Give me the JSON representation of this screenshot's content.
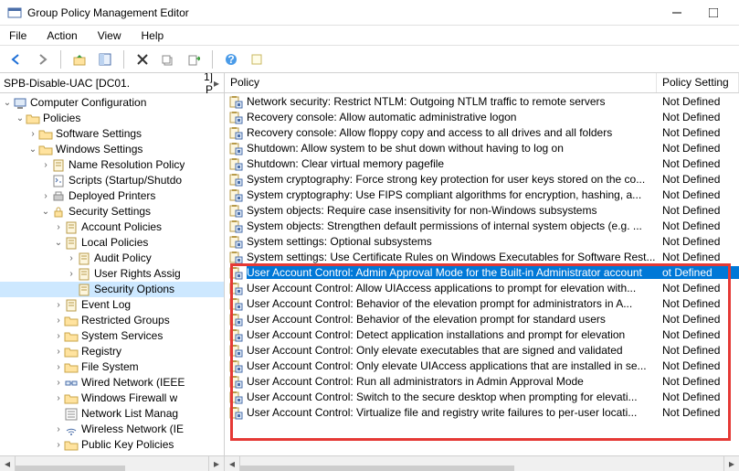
{
  "window": {
    "title": "Group Policy Management Editor"
  },
  "menu": {
    "file": "File",
    "action": "Action",
    "view": "View",
    "help": "Help"
  },
  "tree_header": {
    "label": "SPB-Disable-UAC [DC01.",
    "right": "1] P"
  },
  "tree": [
    {
      "indent": 0,
      "exp": "v",
      "icon": "computer",
      "label": "Computer Configuration"
    },
    {
      "indent": 1,
      "exp": "v",
      "icon": "folder-open",
      "label": "Policies"
    },
    {
      "indent": 2,
      "exp": ">",
      "icon": "folder",
      "label": "Software Settings"
    },
    {
      "indent": 2,
      "exp": "v",
      "icon": "folder-open",
      "label": "Windows Settings"
    },
    {
      "indent": 3,
      "exp": ">",
      "icon": "scroll",
      "label": "Name Resolution Policy"
    },
    {
      "indent": 3,
      "exp": "",
      "icon": "script",
      "label": "Scripts (Startup/Shutdo"
    },
    {
      "indent": 3,
      "exp": ">",
      "icon": "printer",
      "label": "Deployed Printers"
    },
    {
      "indent": 3,
      "exp": "v",
      "icon": "lock",
      "label": "Security Settings"
    },
    {
      "indent": 4,
      "exp": ">",
      "icon": "book",
      "label": "Account Policies"
    },
    {
      "indent": 4,
      "exp": "v",
      "icon": "book",
      "label": "Local Policies"
    },
    {
      "indent": 5,
      "exp": ">",
      "icon": "book",
      "label": "Audit Policy"
    },
    {
      "indent": 5,
      "exp": ">",
      "icon": "book",
      "label": "User Rights Assig"
    },
    {
      "indent": 5,
      "exp": "",
      "icon": "book",
      "label": "Security Options",
      "selected": true
    },
    {
      "indent": 4,
      "exp": ">",
      "icon": "book",
      "label": "Event Log"
    },
    {
      "indent": 4,
      "exp": ">",
      "icon": "folder",
      "label": "Restricted Groups"
    },
    {
      "indent": 4,
      "exp": ">",
      "icon": "folder",
      "label": "System Services"
    },
    {
      "indent": 4,
      "exp": ">",
      "icon": "folder",
      "label": "Registry"
    },
    {
      "indent": 4,
      "exp": ">",
      "icon": "folder",
      "label": "File System"
    },
    {
      "indent": 4,
      "exp": ">",
      "icon": "wired",
      "label": "Wired Network (IEEE"
    },
    {
      "indent": 4,
      "exp": ">",
      "icon": "folder",
      "label": "Windows Firewall w"
    },
    {
      "indent": 4,
      "exp": "",
      "icon": "list",
      "label": "Network List Manag"
    },
    {
      "indent": 4,
      "exp": ">",
      "icon": "wifi",
      "label": "Wireless Network (IE"
    },
    {
      "indent": 4,
      "exp": ">",
      "icon": "folder",
      "label": "Public Key Policies"
    }
  ],
  "list_header": {
    "policy": "Policy",
    "setting": "Policy Setting"
  },
  "rows": [
    {
      "label": "Network security: Restrict NTLM: Outgoing NTLM traffic to remote servers",
      "setting": "Not Defined"
    },
    {
      "label": "Recovery console: Allow automatic administrative logon",
      "setting": "Not Defined"
    },
    {
      "label": "Recovery console: Allow floppy copy and access to all drives and all folders",
      "setting": "Not Defined"
    },
    {
      "label": "Shutdown: Allow system to be shut down without having to log on",
      "setting": "Not Defined"
    },
    {
      "label": "Shutdown: Clear virtual memory pagefile",
      "setting": "Not Defined"
    },
    {
      "label": "System cryptography: Force strong key protection for user keys stored on the co...",
      "setting": "Not Defined"
    },
    {
      "label": "System cryptography: Use FIPS compliant algorithms for encryption, hashing, a...",
      "setting": "Not Defined"
    },
    {
      "label": "System objects: Require case insensitivity for non-Windows subsystems",
      "setting": "Not Defined"
    },
    {
      "label": "System objects: Strengthen default permissions of internal system objects (e.g. ...",
      "setting": "Not Defined"
    },
    {
      "label": "System settings: Optional subsystems",
      "setting": "Not Defined"
    },
    {
      "label": "System settings: Use Certificate Rules on Windows Executables for Software Rest...",
      "setting": "Not Defined"
    },
    {
      "label": "User Account Control: Admin Approval Mode for the Built-in Administrator account",
      "setting": "ot Defined",
      "selected": true
    },
    {
      "label": "User Account Control: Allow UIAccess applications to prompt for elevation with...",
      "setting": "Not Defined"
    },
    {
      "label": "User Account Control: Behavior of the elevation prompt for administrators in A...",
      "setting": "Not Defined"
    },
    {
      "label": "User Account Control: Behavior of the elevation prompt for standard users",
      "setting": "Not Defined"
    },
    {
      "label": "User Account Control: Detect application installations and prompt for elevation",
      "setting": "Not Defined"
    },
    {
      "label": "User Account Control: Only elevate executables that are signed and validated",
      "setting": "Not Defined"
    },
    {
      "label": "User Account Control: Only elevate UIAccess applications that are installed in se...",
      "setting": "Not Defined"
    },
    {
      "label": "User Account Control: Run all administrators in Admin Approval Mode",
      "setting": "Not Defined"
    },
    {
      "label": "User Account Control: Switch to the secure desktop when prompting for elevati...",
      "setting": "Not Defined"
    },
    {
      "label": "User Account Control: Virtualize file and registry write failures to per-user locati...",
      "setting": "Not Defined"
    }
  ]
}
